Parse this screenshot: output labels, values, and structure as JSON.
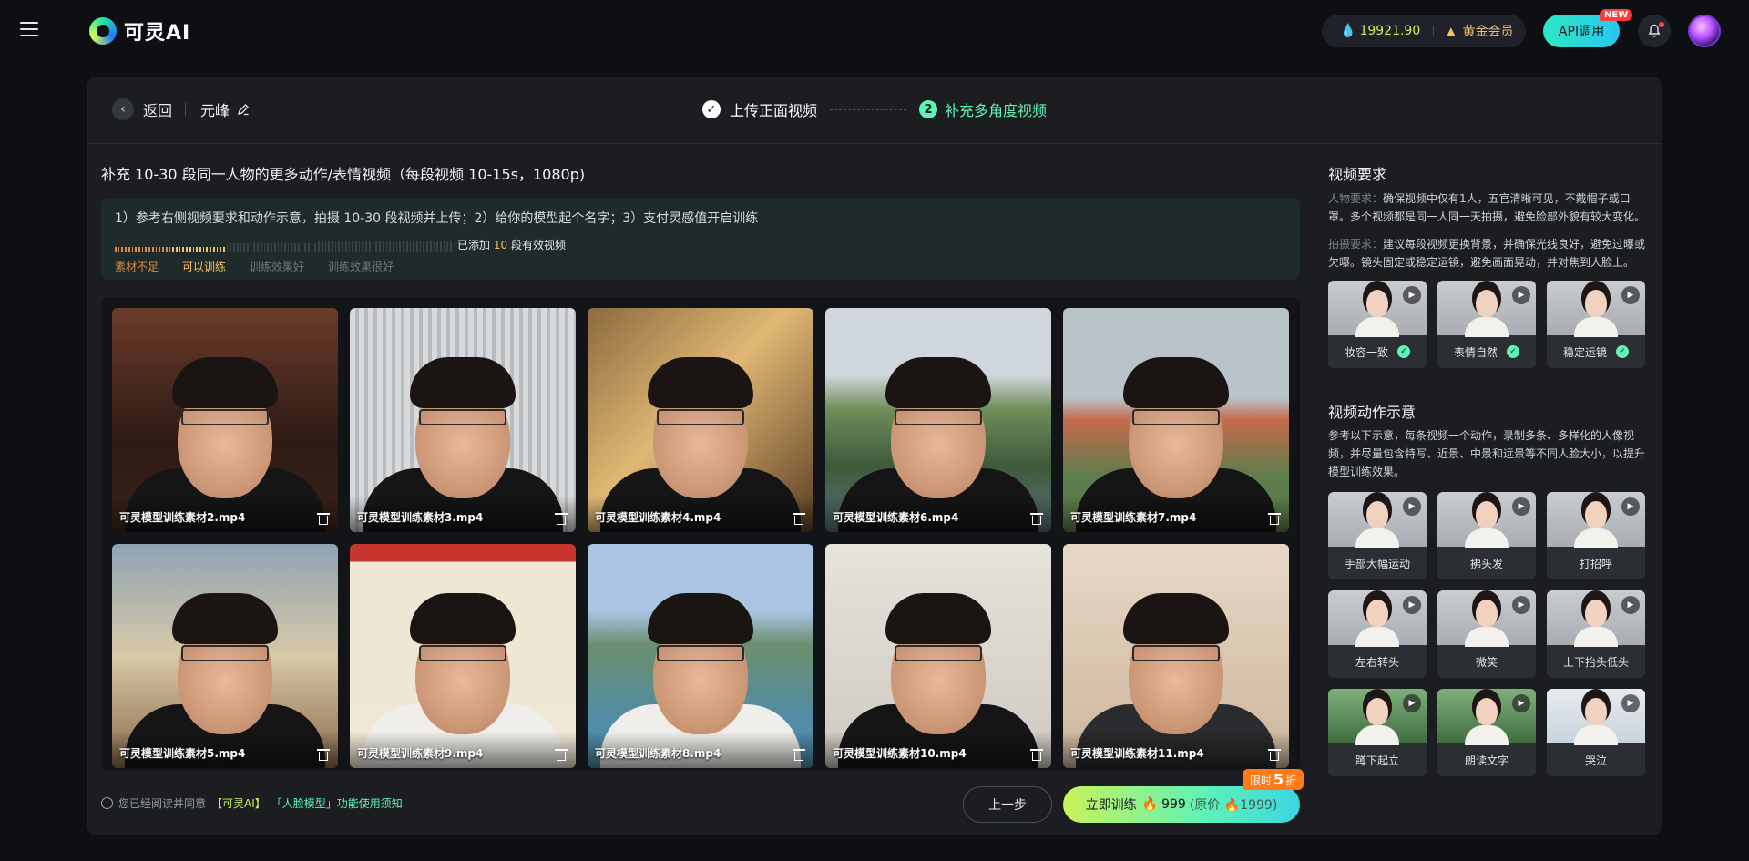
{
  "app": {
    "logo_text": "可灵AI"
  },
  "topbar": {
    "points": "19921.90",
    "membership": "黄金会员",
    "api_label": "API调用",
    "new_badge": "NEW"
  },
  "header": {
    "back_label": "返回",
    "model_name": "元峰",
    "step1_label": "上传正面视频",
    "step2_number": "2",
    "step2_label": "补充多角度视频"
  },
  "main": {
    "title": "补充 10-30 段同一人物的更多动作/表情视频（每段视频 10-15s，1080p)",
    "instructions": "1）参考右侧视频要求和动作示意，拍摄 10-30 段视频并上传；2）给你的模型起个名字；3）支付灵感值开启训练",
    "added_prefix": "已添加",
    "added_count": "10",
    "added_suffix": "段有效视频",
    "progress_fraction": 0.33,
    "levels": [
      "素材不足",
      "可以训练",
      "训练效果好",
      "训练效果很好"
    ],
    "videos": [
      {
        "name": "可灵模型训练素材2.mp4",
        "scene": "bookshelf",
        "shirt": "dark"
      },
      {
        "name": "可灵模型训练素材3.mp4",
        "scene": "blinds",
        "shirt": "dark"
      },
      {
        "name": "可灵模型训练素材4.mp4",
        "scene": "warm",
        "shirt": "dark"
      },
      {
        "name": "可灵模型训练素材6.mp4",
        "scene": "lake",
        "shirt": "dark"
      },
      {
        "name": "可灵模型训练素材7.mp4",
        "scene": "park",
        "shirt": "dark"
      },
      {
        "name": "可灵模型训练素材5.mp4",
        "scene": "tent",
        "shirt": "dark"
      },
      {
        "name": "可灵模型训练素材9.mp4",
        "scene": "mahjong",
        "shirt": "white"
      },
      {
        "name": "可灵模型训练素材8.mp4",
        "scene": "city",
        "shirt": "white"
      },
      {
        "name": "可灵模型训练素材10.mp4",
        "scene": "wall",
        "shirt": "dark"
      },
      {
        "name": "可灵模型训练素材11.mp4",
        "scene": "beige",
        "shirt": "jacket"
      }
    ],
    "agree_prefix": "您已经阅读并同意",
    "agree_brand": "【可灵AI】",
    "agree_doc": "「人脸模型」功能使用须知",
    "prev_label": "上一步",
    "train_label": "立即训练",
    "train_price": "999",
    "orig_prefix": "(原价",
    "orig_price": "1999",
    "orig_suffix": ")",
    "promo_prefix": "限时",
    "promo_value": "5",
    "promo_suffix": "折"
  },
  "right": {
    "req_title": "视频要求",
    "person_label": "人物要求：",
    "person_text": "确保视频中仅有1人，五官清晰可见，不戴帽子或口罩。多个视频都是同一人同一天拍摄，避免脸部外貌有较大变化。",
    "shoot_label": "拍摄要求：",
    "shoot_text": "建议每段视频更换背景，并确保光线良好，避免过曝或欠曝。镜头固定或稳定运镜，避免画面晃动，并对焦到人脸上。",
    "req_cards": [
      "妆容一致",
      "表情自然",
      "稳定运镜"
    ],
    "demo_title": "视频动作示意",
    "demo_text": "参考以下示意，每条视频一个动作，录制多条、多样化的人像视频，并尽量包含特写、近景、中景和远景等不同人脸大小，以提升模型训练效果。",
    "demo_cards": [
      "手部大幅运动",
      "拂头发",
      "打招呼",
      "左右转头",
      "微笑",
      "上下抬头低头",
      "蹲下起立",
      "朗读文字",
      "哭泣"
    ]
  },
  "colors": {
    "accent": "#5ef2b6",
    "lime": "#c9f25a",
    "warning": "#e58a3a",
    "gold": "#f6c25a",
    "promo": "#ff7a1a"
  }
}
